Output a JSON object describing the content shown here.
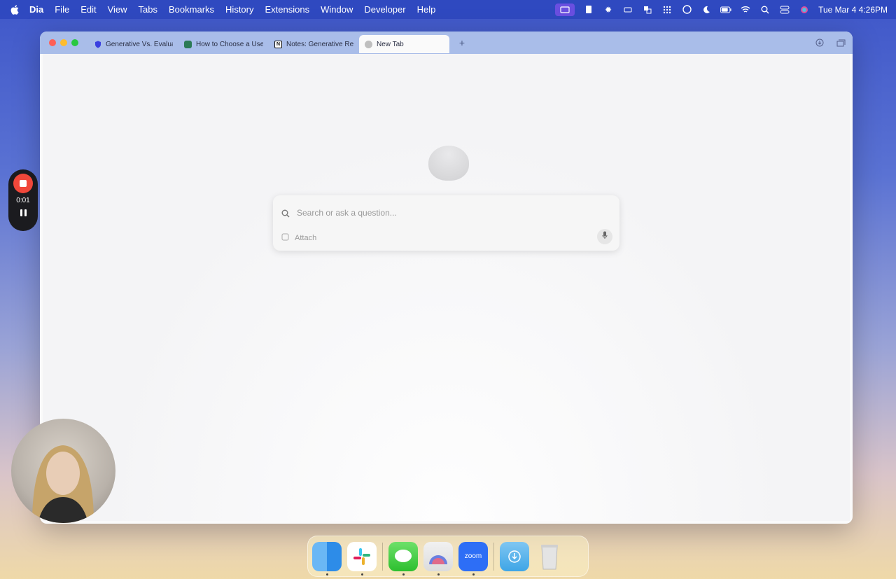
{
  "menubar": {
    "app_name": "Dia",
    "items": [
      "File",
      "Edit",
      "View",
      "Tabs",
      "Bookmarks",
      "History",
      "Extensions",
      "Window",
      "Developer",
      "Help"
    ],
    "clock": "Tue Mar 4  4:26PM"
  },
  "tabs": [
    {
      "label": "Generative Vs. Evaluat",
      "icon": "shield-favicon"
    },
    {
      "label": "How to Choose a User",
      "icon": "dots-favicon"
    },
    {
      "label": "Notes: Generative Rese",
      "icon": "notion-favicon"
    },
    {
      "label": "New Tab",
      "icon": "globe-favicon",
      "active": true
    }
  ],
  "search": {
    "placeholder": "Search or ask a question...",
    "attach_label": "Attach"
  },
  "recorder": {
    "time": "0:01"
  },
  "dock": {
    "apps": [
      {
        "name": "Finder",
        "running": true
      },
      {
        "name": "Slack",
        "running": true
      },
      {
        "name": "Messages",
        "running": true
      },
      {
        "name": "Dia",
        "running": true
      },
      {
        "name": "zoom",
        "running": true
      },
      {
        "name": "Downloads",
        "running": false
      },
      {
        "name": "Trash",
        "running": false
      }
    ],
    "zoom_label": "zoom"
  },
  "colors": {
    "accent": "#a9bde9",
    "record": "#f0473a"
  }
}
